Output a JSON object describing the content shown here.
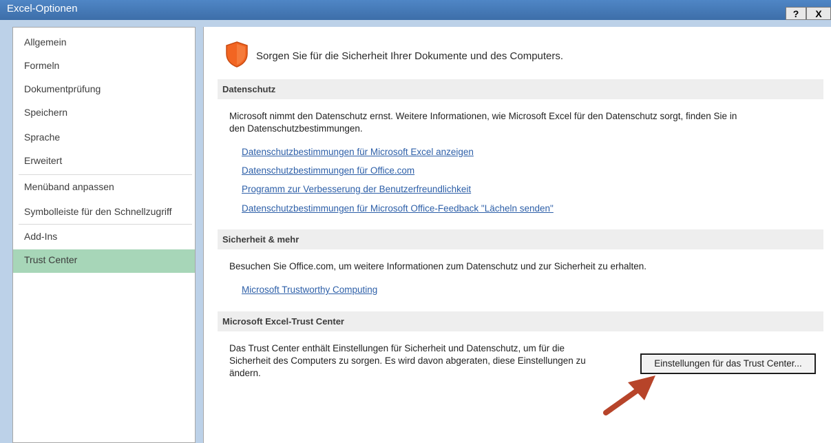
{
  "window": {
    "title": "Excel-Optionen",
    "help_label": "?",
    "close_label": "X"
  },
  "sidebar": {
    "items": [
      {
        "label": "Allgemein"
      },
      {
        "label": "Formeln"
      },
      {
        "label": "Dokumentprüfung"
      },
      {
        "label": "Speichern"
      },
      {
        "label": "Sprache"
      },
      {
        "label": "Erweitert"
      },
      {
        "label": "Menüband anpassen"
      },
      {
        "label": "Symbolleiste für den Schnellzugriff"
      },
      {
        "label": "Add-Ins"
      },
      {
        "label": "Trust Center"
      }
    ],
    "selected": "Trust Center"
  },
  "main": {
    "header": "Sorgen Sie für die Sicherheit Ihrer Dokumente und des Computers.",
    "privacy": {
      "heading": "Datenschutz",
      "text_line1": "Microsoft nimmt den Datenschutz ernst. Weitere Informationen, wie Microsoft Excel für den Datenschutz sorgt, finden Sie in",
      "text_line2": "den Datenschutzbestimmungen.",
      "links": [
        "Datenschutzbestimmungen für Microsoft Excel anzeigen",
        "Datenschutzbestimmungen für Office.com",
        "Programm zur Verbesserung der Benutzerfreundlichkeit",
        "Datenschutzbestimmungen für Microsoft Office-Feedback \"Lächeln senden\""
      ]
    },
    "security": {
      "heading": "Sicherheit & mehr",
      "text": "Besuchen Sie Office.com, um weitere Informationen zum Datenschutz und zur Sicherheit zu erhalten.",
      "link": "Microsoft Trustworthy Computing"
    },
    "trust_center": {
      "heading": "Microsoft Excel-Trust Center",
      "text_line1": "Das Trust Center enthält Einstellungen für Sicherheit und Datenschutz, um für die",
      "text_line2": "Sicherheit des Computers zu sorgen. Es wird davon abgeraten, diese Einstellungen zu",
      "text_line3": "ändern.",
      "button_label": "Einstellungen für das Trust Center..."
    }
  },
  "colors": {
    "selected_nav": "#a7d6b8",
    "link": "#2d5fa8",
    "shield": "#f26522",
    "arrow": "#b7442a"
  },
  "icons": {
    "shield": "shield-icon",
    "arrow": "red-arrow-annotation"
  }
}
